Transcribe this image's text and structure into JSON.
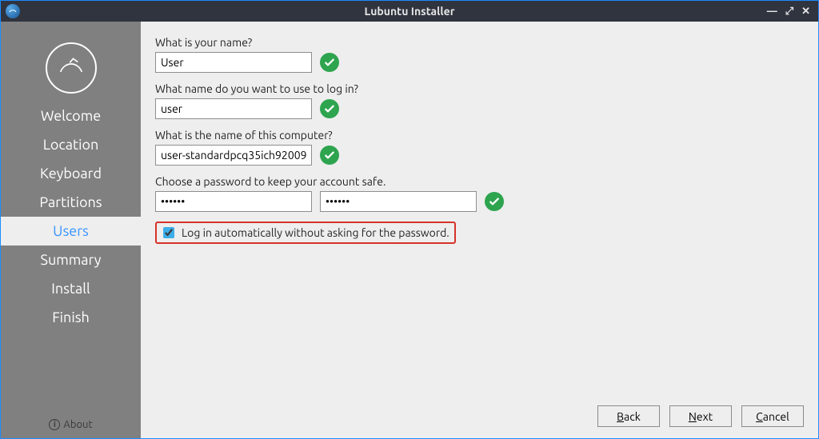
{
  "window": {
    "title": "Lubuntu Installer"
  },
  "sidebar": {
    "steps": [
      "Welcome",
      "Location",
      "Keyboard",
      "Partitions",
      "Users",
      "Summary",
      "Install",
      "Finish"
    ],
    "active_index": 4,
    "about": "About"
  },
  "form": {
    "name_label": "What is your name?",
    "name_value": "User",
    "login_label": "What name do you want to use to log in?",
    "login_value": "user",
    "computer_label": "What is the name of this computer?",
    "computer_value": "user-standardpcq35ich92009",
    "password_label": "Choose a password to keep your account safe.",
    "password_value": "••••••",
    "password_confirm_value": "••••••",
    "autologin_label": "Log in automatically without asking for the password.",
    "autologin_checked": true
  },
  "buttons": {
    "back": "Back",
    "next": "Next",
    "cancel": "Cancel"
  }
}
